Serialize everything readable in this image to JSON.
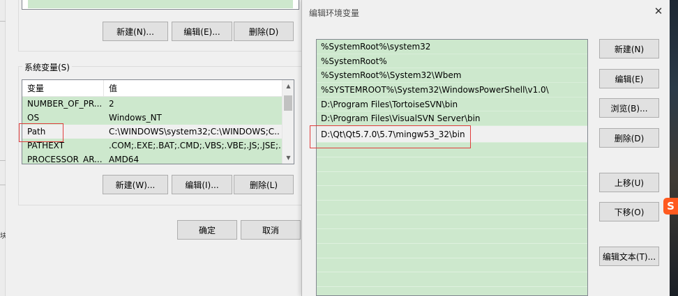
{
  "env_window": {
    "user_buttons": {
      "new": "新建(N)...",
      "edit": "编辑(E)...",
      "delete": "删除(D)"
    },
    "system_group_label": "系统变量(S)",
    "system_table": {
      "col_name": "变量",
      "col_value": "值",
      "rows": [
        {
          "name": "NUMBER_OF_PR...",
          "value": "2"
        },
        {
          "name": "OS",
          "value": "Windows_NT"
        },
        {
          "name": "Path",
          "value": "C:\\WINDOWS\\system32;C:\\WINDOWS;C..."
        },
        {
          "name": "PATHEXT",
          "value": ".COM;.EXE;.BAT;.CMD;.VBS;.VBE;.JS;.JSE;..."
        },
        {
          "name": "PROCESSOR_AR...",
          "value": "AMD64"
        }
      ]
    },
    "system_buttons": {
      "new": "新建(W)...",
      "edit": "编辑(I)...",
      "delete": "删除(L)"
    },
    "ok": "确定",
    "cancel": "取消"
  },
  "edit_window": {
    "title": "编辑环境变量",
    "close_glyph": "✕",
    "paths": [
      "%SystemRoot%\\system32",
      "%SystemRoot%",
      "%SystemRoot%\\System32\\Wbem",
      "%SYSTEMROOT%\\System32\\WindowsPowerShell\\v1.0\\",
      "D:\\Program Files\\TortoiseSVN\\bin",
      "D:\\Program Files\\VisualSVN Server\\bin",
      "D:\\Qt\\Qt5.7.0\\5.7\\mingw53_32\\bin"
    ],
    "buttons": {
      "new": "新建(N)",
      "edit": "编辑(E)",
      "browse": "浏览(B)...",
      "delete": "删除(D)",
      "move_up": "上移(U)",
      "move_down": "下移(O)",
      "edit_text": "编辑文本(T)..."
    }
  },
  "desktop": {
    "sogou_glyph": "S"
  },
  "colors": {
    "row_green": "#cde8cd",
    "highlight_red": "#e03c3c"
  }
}
